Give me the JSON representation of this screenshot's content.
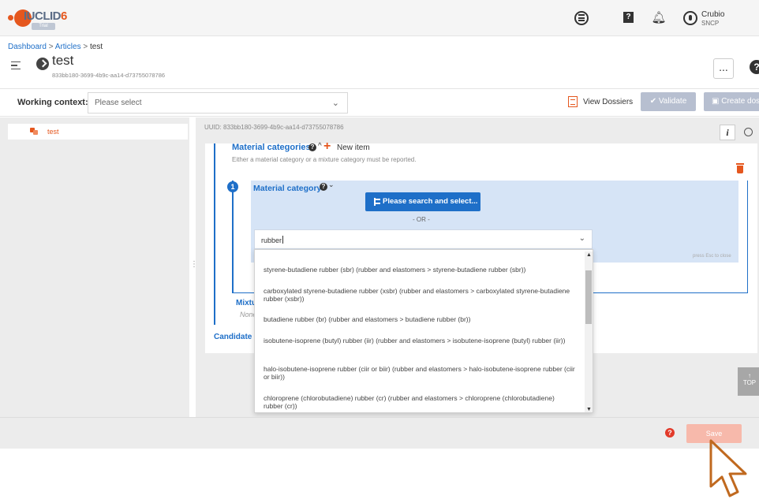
{
  "app": {
    "logo_text": "IUCLID",
    "logo_version": "6",
    "logo_badge": "Trial"
  },
  "topbar": {
    "user_name": "Crubio",
    "user_org": "SNCP"
  },
  "breadcrumb": {
    "dashboard": "Dashboard",
    "articles": "Articles",
    "current": "test",
    "separator": ">"
  },
  "entity": {
    "title": "test",
    "uuid": "833bb180-3699-4b9c-aa14-d73755078786",
    "more_label": "..."
  },
  "context": {
    "label": "Working context:",
    "placeholder": "Please select"
  },
  "actions": {
    "view_dossiers": "View Dossiers",
    "validate": "Validate",
    "create_dossier": "Create doss"
  },
  "tree": {
    "item_label": "test"
  },
  "content": {
    "uuid_line": "UUID: 833bb180-3699-4b9c-aa14-d73755078786",
    "info_label": "i",
    "material_categories_title": "Material categories",
    "new_item": "New item",
    "note": "Either a material category or a mixture category must be reported.",
    "block_number": "1",
    "material_category_title": "Material category",
    "search_button": "Please search and select...",
    "or_text": "- OR -",
    "combo_value": "rubber",
    "press_esc": "press Esc to close",
    "mixture_label": "Mixtu",
    "mixture_none": "None",
    "candidate_label": "Candidate l"
  },
  "dropdown": {
    "options": [
      "styrene-butadiene rubber (sbr) (rubber and elastomers > styrene-butadiene rubber (sbr))",
      "carboxylated styrene-butadiene rubber (xsbr) (rubber and elastomers > carboxylated styrene-butadiene rubber (xsbr))",
      "butadiene rubber (br) (rubber and elastomers > butadiene rubber (br))",
      "isobutene-isoprene (butyl) rubber (iir) (rubber and elastomers > isobutene-isoprene (butyl) rubber (iir))",
      "halo-isobutene-isoprene rubber (ciir or biir) (rubber and elastomers > halo-isobutene-isoprene rubber (ciir or biir))",
      "chloroprene (chlorobutadiene) rubber (cr) (rubber and elastomers > chloroprene (chlorobutadiene) rubber (cr))"
    ]
  },
  "footer": {
    "save": "Save",
    "help": "?"
  },
  "top_button": "TOP",
  "colors": {
    "accent_blue": "#1e6fc8",
    "brand_orange": "#e5571e",
    "save_disabled": "#f7b9ab"
  }
}
